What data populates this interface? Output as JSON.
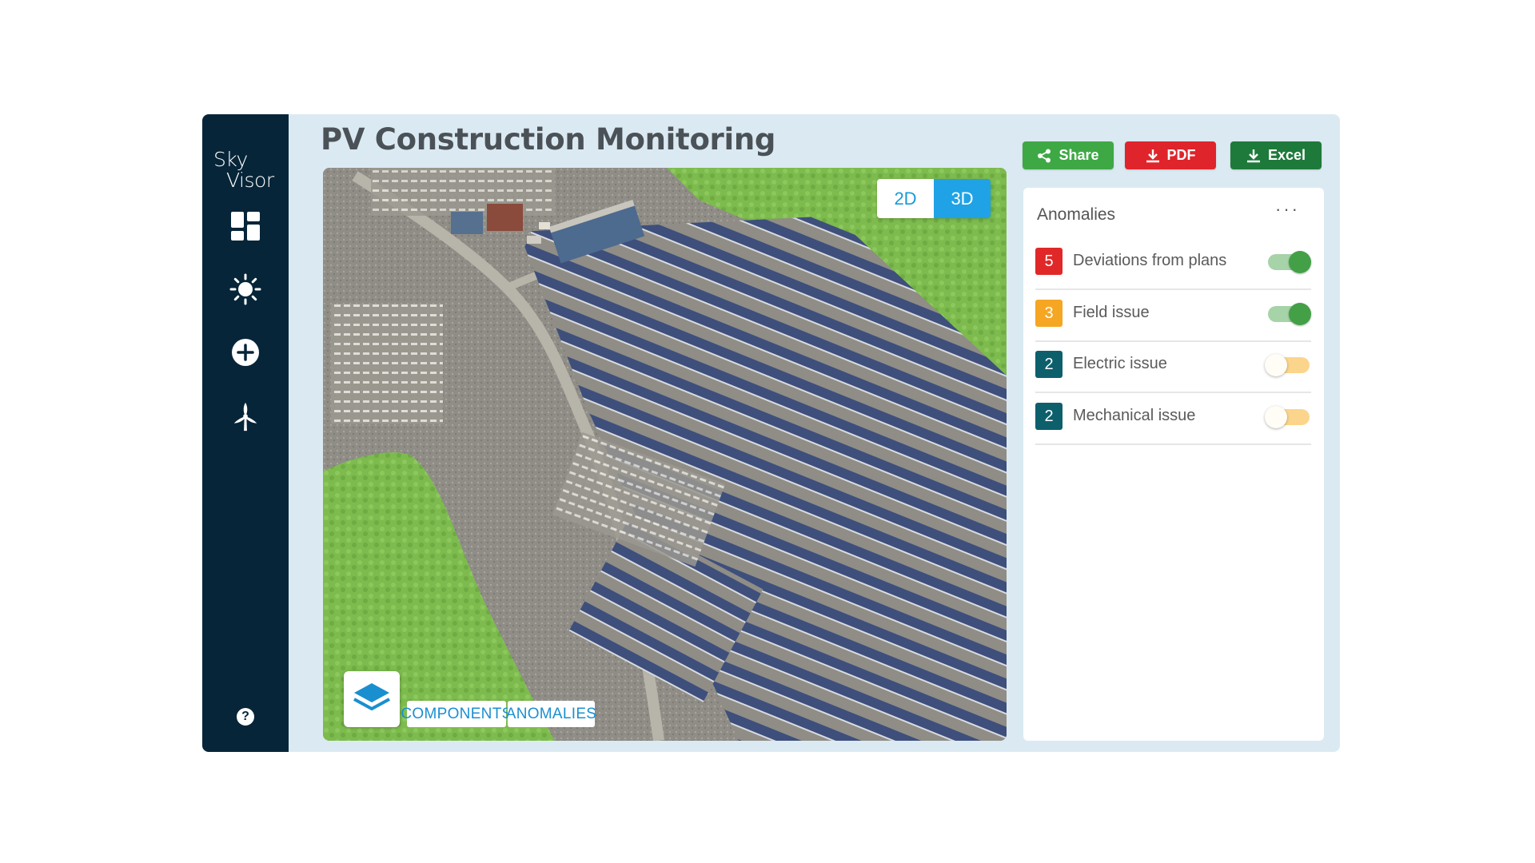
{
  "brand": {
    "line1": "Sky",
    "line2": "Visor"
  },
  "page": {
    "title": "PV Construction Monitoring"
  },
  "sidebar": {
    "items": [
      {
        "icon": "dashboard-icon"
      },
      {
        "icon": "sun-icon"
      },
      {
        "icon": "add-circle-icon"
      },
      {
        "icon": "wind-turbine-icon"
      }
    ],
    "help_label": "?"
  },
  "toolbar": {
    "share_label": "Share",
    "pdf_label": "PDF",
    "excel_label": "Excel",
    "colors": {
      "share": "#3ea845",
      "pdf": "#e0242b",
      "excel": "#1e7a3a"
    }
  },
  "map": {
    "view_2d_label": "2D",
    "view_3d_label": "3D",
    "active_view": "3D",
    "layers_icon": "layers-icon",
    "chips": [
      "COMPONENTS",
      "ANOMALIES"
    ]
  },
  "anomalies": {
    "title": "Anomalies",
    "more_label": "···",
    "items": [
      {
        "count": "5",
        "label": "Deviations from plans",
        "color": "#e02828",
        "enabled": true
      },
      {
        "count": "3",
        "label": "Field issue",
        "color": "#f5a623",
        "enabled": true
      },
      {
        "count": "2",
        "label": "Electric issue",
        "color": "#0d5f6c",
        "enabled": false
      },
      {
        "count": "2",
        "label": "Mechanical issue",
        "color": "#0d5f6c",
        "enabled": false
      }
    ]
  }
}
